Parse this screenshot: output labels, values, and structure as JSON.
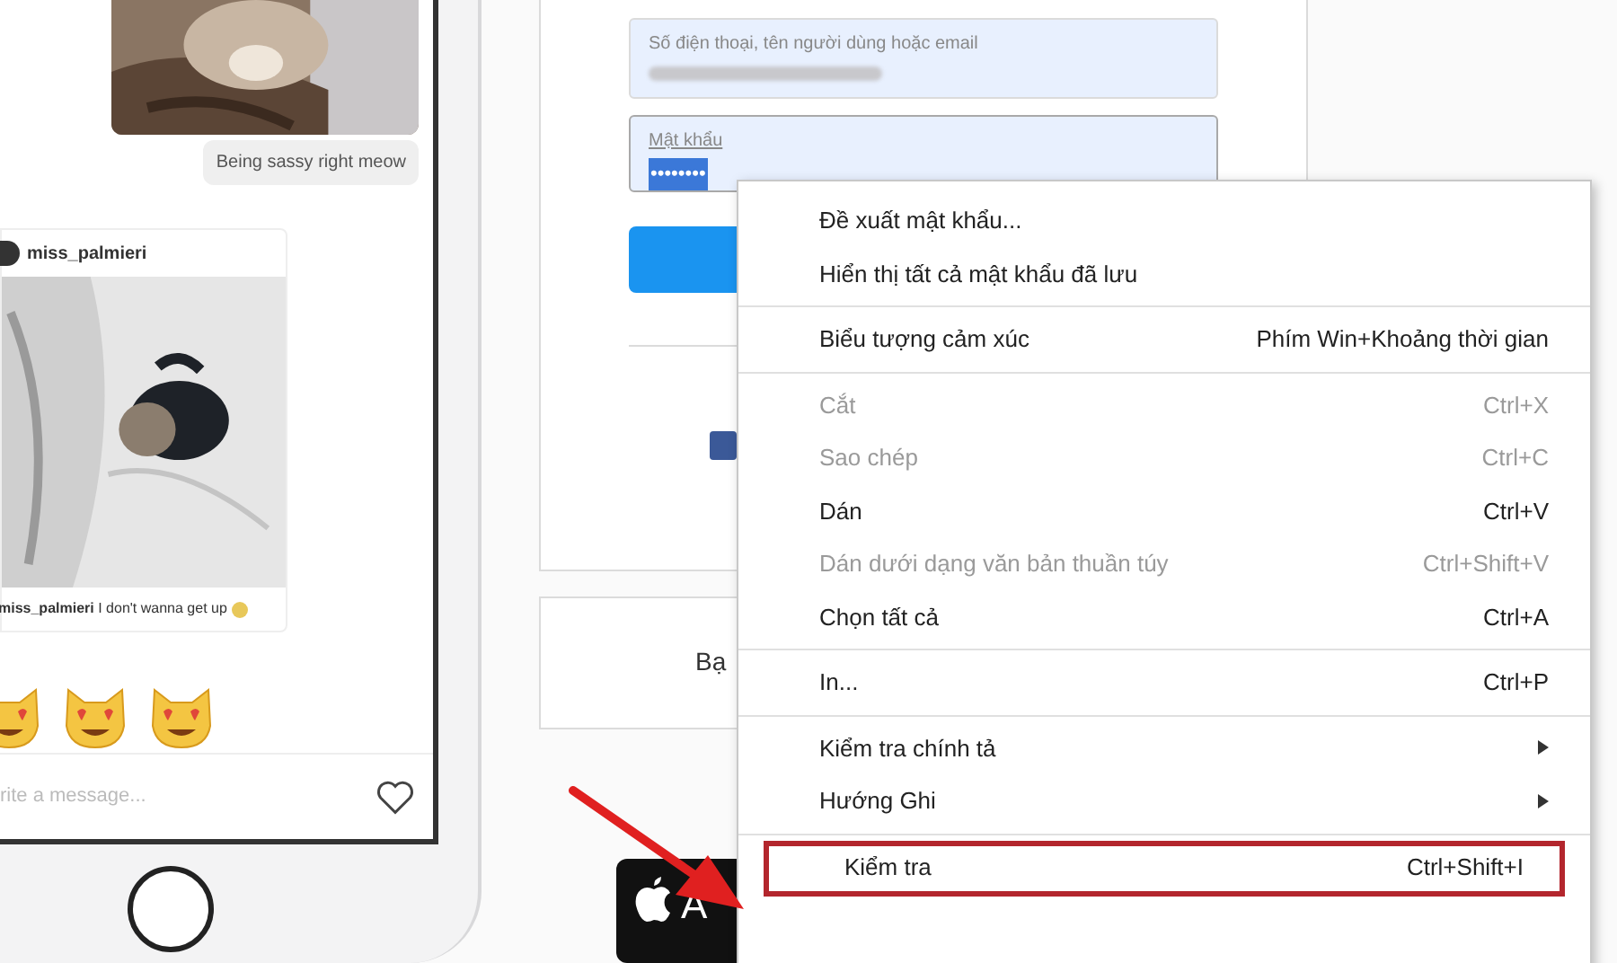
{
  "chat": {
    "bubble": "Being sassy right meow",
    "post": {
      "username": "miss_palmieri",
      "caption_user": "miss_palmieri",
      "caption": "I don't wanna get up"
    },
    "reactions": [
      {
        "kind": "cat"
      },
      {
        "kind": "cat"
      },
      {
        "kind": "cat"
      }
    ],
    "composer": {
      "placeholder": "rite a message..."
    }
  },
  "login": {
    "username_field": {
      "placeholder": "Số điện thoại, tên người dùng hoặc email"
    },
    "password_field": {
      "placeholder": "Mật khẩu",
      "value": "••••••••"
    },
    "signup_card": {
      "text": "Bạ"
    },
    "app_badge": {
      "large": "A"
    }
  },
  "context_menu": {
    "groups": [
      [
        {
          "label": "Đề xuất mật khẩu...",
          "disabled": false,
          "submenu": false,
          "boxed": false
        },
        {
          "label": "Hiển thị tất cả mật khẩu đã lưu",
          "disabled": false,
          "submenu": false,
          "boxed": false
        }
      ],
      [
        {
          "label": "Biểu tượng cảm xúc",
          "shortcut": "Phím Win+Khoảng thời gian",
          "disabled": false,
          "submenu": false,
          "boxed": false
        }
      ],
      [
        {
          "label": "Cắt",
          "shortcut": "Ctrl+X",
          "disabled": true,
          "submenu": false,
          "boxed": false
        },
        {
          "label": "Sao chép",
          "shortcut": "Ctrl+C",
          "disabled": true,
          "submenu": false,
          "boxed": false
        },
        {
          "label": "Dán",
          "shortcut": "Ctrl+V",
          "disabled": false,
          "submenu": false,
          "boxed": false
        },
        {
          "label": "Dán dưới dạng văn bản thuần túy",
          "shortcut": "Ctrl+Shift+V",
          "disabled": true,
          "submenu": false,
          "boxed": false
        },
        {
          "label": "Chọn tất cả",
          "shortcut": "Ctrl+A",
          "disabled": false,
          "submenu": false,
          "boxed": false
        }
      ],
      [
        {
          "label": "In...",
          "shortcut": "Ctrl+P",
          "disabled": false,
          "submenu": false,
          "boxed": false
        }
      ],
      [
        {
          "label": "Kiểm tra chính tả",
          "disabled": false,
          "submenu": true,
          "boxed": false
        },
        {
          "label": "Hướng Ghi",
          "disabled": false,
          "submenu": true,
          "boxed": false
        }
      ],
      [
        {
          "label": "Kiểm tra",
          "shortcut": "Ctrl+Shift+I",
          "disabled": false,
          "submenu": false,
          "boxed": true
        }
      ]
    ]
  }
}
